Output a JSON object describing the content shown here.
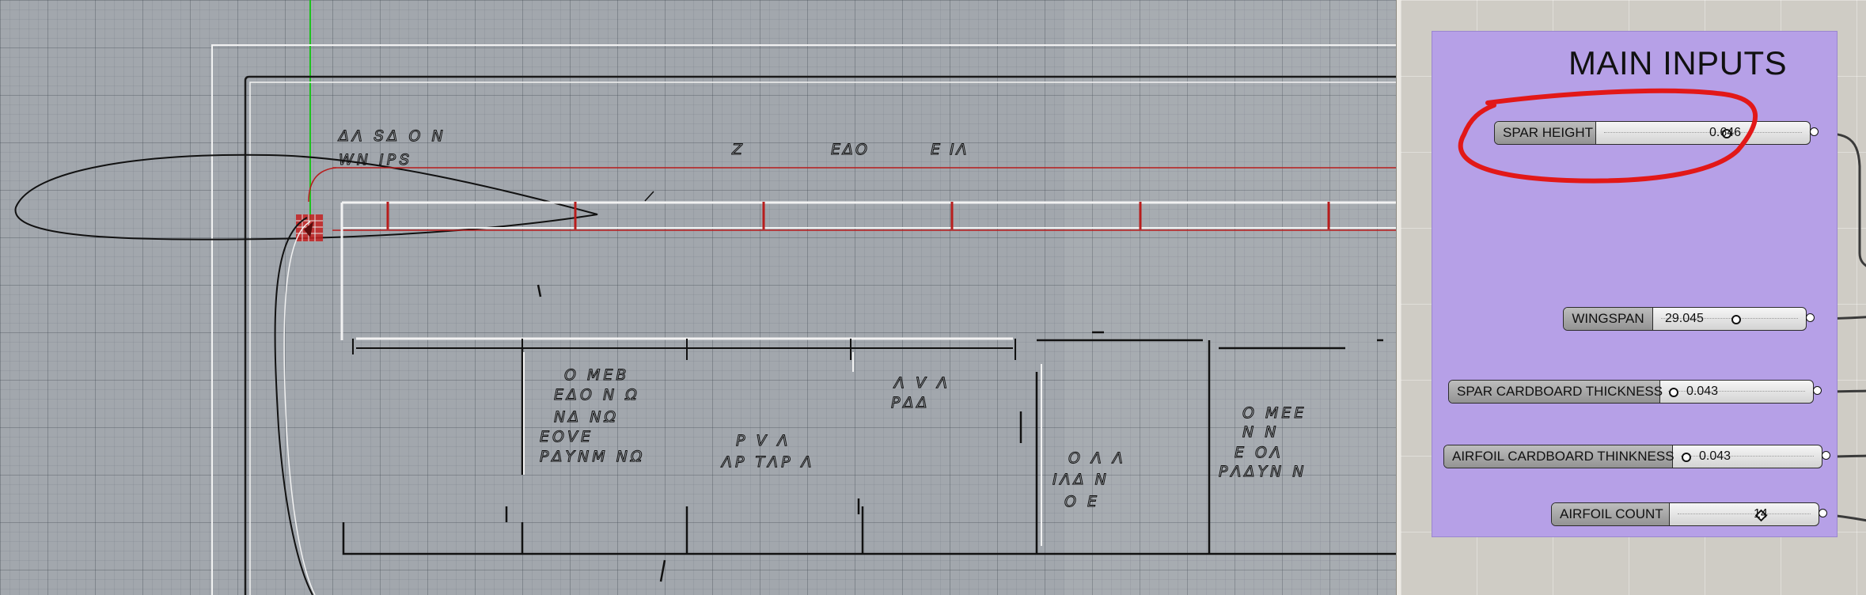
{
  "group": {
    "title": "MAIN INPUTS",
    "color": "#b6a0e7"
  },
  "sliders": [
    {
      "label": "SPAR HEIGHT",
      "value": "0.646",
      "grip": "circle",
      "position": 0.62
    },
    {
      "label": "WINGSPAN",
      "value": "29.045",
      "grip": "circle",
      "position": 0.55
    },
    {
      "label": "SPAR CARDBOARD THICKNESS",
      "value": "0.043",
      "grip": "circle",
      "position": 0.04
    },
    {
      "label": "AIRFOIL CARDBOARD THINKNESS",
      "value": "0.043",
      "grip": "circle",
      "position": 0.04
    },
    {
      "label": "AIRFOIL COUNT",
      "value": "14",
      "grip": "diamond",
      "position": 0.63
    }
  ],
  "annotation": {
    "color": "#e21818",
    "target": "SPAR HEIGHT"
  },
  "viewport": {
    "background": "#a2a7ad",
    "curve_color": "#111111",
    "red_color": "#b81c1c",
    "axis_color": "#1dc21d"
  }
}
